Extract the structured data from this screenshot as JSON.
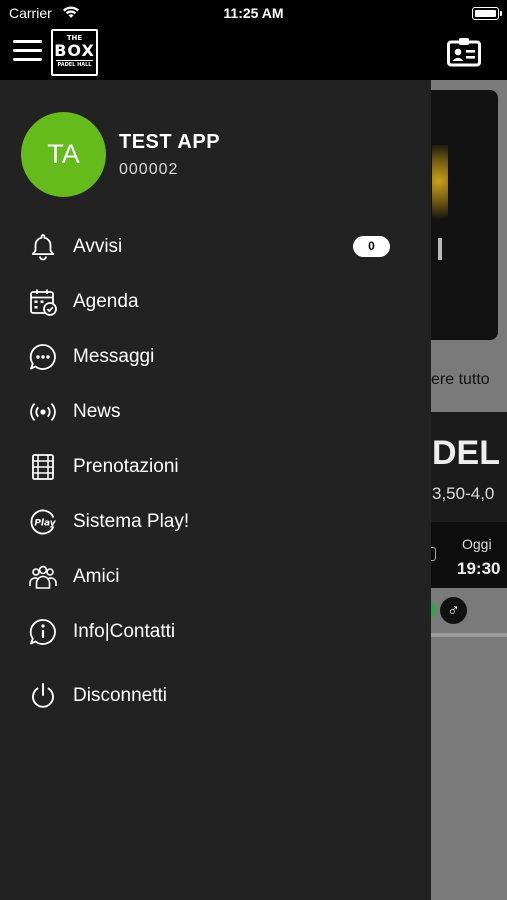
{
  "status_bar": {
    "carrier": "Carrier",
    "time": "11:25 AM"
  },
  "header": {
    "logo": {
      "line1": "THE",
      "line2": "BOX",
      "line3": "PADEL HALL"
    }
  },
  "user": {
    "initials": "TA",
    "name": "TEST APP",
    "code": "000002",
    "avatar_color": "#66bb1c"
  },
  "menu": {
    "items": [
      {
        "label": "Avvisi",
        "icon": "bell-icon",
        "badge": "0"
      },
      {
        "label": "Agenda",
        "icon": "calendar-check-icon"
      },
      {
        "label": "Messaggi",
        "icon": "chat-bubble-icon"
      },
      {
        "label": "News",
        "icon": "broadcast-icon"
      },
      {
        "label": "Prenotazioni",
        "icon": "court-grid-icon"
      },
      {
        "label": "Sistema Play!",
        "icon": "play-logo-icon"
      },
      {
        "label": "Amici",
        "icon": "friends-icon"
      },
      {
        "label": "Info|Contatti",
        "icon": "info-chat-icon"
      },
      {
        "label": "Disconnetti",
        "icon": "power-icon"
      }
    ]
  },
  "background": {
    "see_all": "ere tutto",
    "card_title": "DEL",
    "card_subtitle": "3,50-4,0",
    "card_day": "Oggi",
    "card_time": "19:30",
    "gender_symbol": "♂"
  },
  "colors": {
    "drawer_bg": "#222222",
    "accent_green": "#66bb1c",
    "overlay": "#7a7a7a"
  }
}
